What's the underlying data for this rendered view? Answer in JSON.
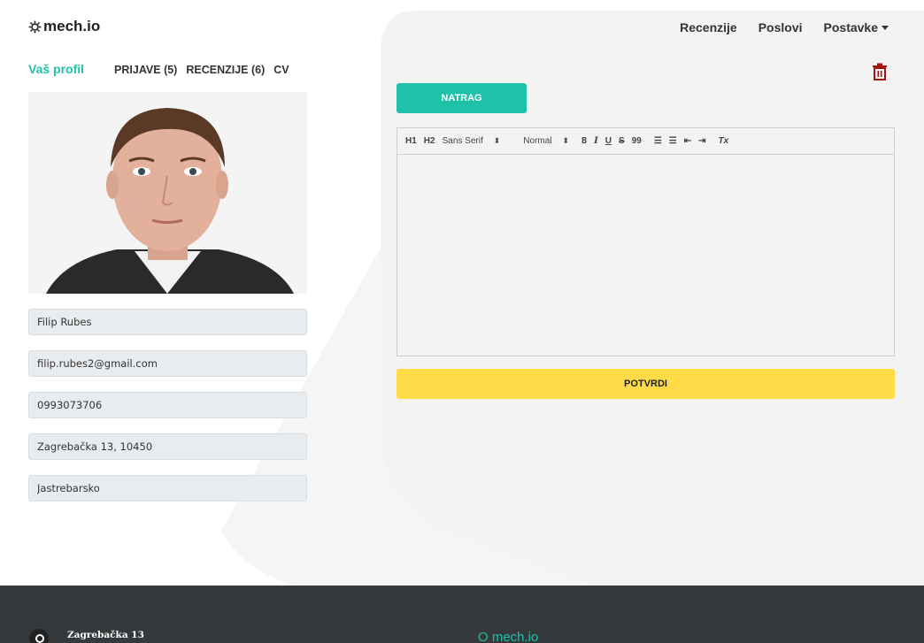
{
  "brand": {
    "name": "mech.io",
    "icon": "gear-icon"
  },
  "nav": {
    "reviews": "Recenzije",
    "jobs": "Poslovi",
    "settings": "Postavke"
  },
  "profile": {
    "title": "Vaš profil",
    "tabs": [
      "PRIJAVE (5)",
      "RECENZIJE (6)",
      "CV"
    ],
    "fields": {
      "name": "Filip Rubes",
      "email": "filip.rubes2@gmail.com",
      "phone": "0993073706",
      "address": "Zagrebačka 13, 10450",
      "city": "Jastrebarsko"
    }
  },
  "actions": {
    "back": "NATRAG",
    "confirm": "POTVRDI",
    "delete_icon": "trash-icon"
  },
  "editor": {
    "toolbar": {
      "h1": "H1",
      "h2": "H2",
      "font": "Sans Serif",
      "size": "Normal",
      "bold": "B",
      "italic": "I",
      "underline": "U",
      "strike": "S",
      "quote": "99",
      "clear": "Tx"
    },
    "content": ""
  },
  "footer": {
    "address": "Zagrebačka 13",
    "about": "O mech.io"
  },
  "colors": {
    "accent": "#1fc2a9",
    "confirm": "#ffdb47",
    "footer": "#35393c",
    "danger": "#a31515"
  }
}
